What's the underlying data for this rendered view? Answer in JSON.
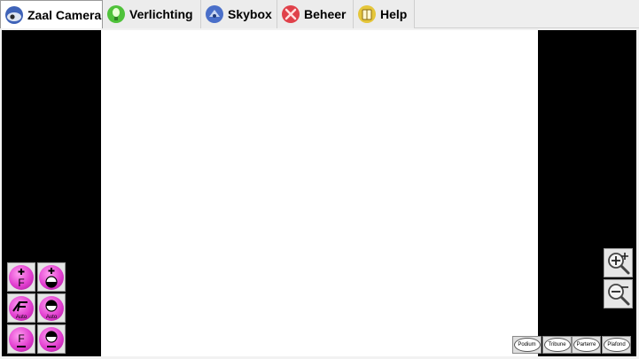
{
  "tabs": [
    {
      "label": "Zaal Camera",
      "icon": "camera-icon",
      "active": true
    },
    {
      "label": "Verlichting",
      "icon": "lightbulb-icon",
      "active": false
    },
    {
      "label": "Skybox",
      "icon": "skybox-icon",
      "active": false
    },
    {
      "label": "Beheer",
      "icon": "tools-icon",
      "active": false
    },
    {
      "label": "Help",
      "icon": "book-icon",
      "active": false
    }
  ],
  "camera_controls": {
    "focus_auto_label": "Auto",
    "iris_auto_label": "Auto",
    "focus_letter": "F"
  },
  "presets": [
    "Podium",
    "Tribune",
    "Parterre",
    "Plafond"
  ],
  "colors": {
    "accent_magenta": "#e23fd0",
    "panel_black": "#000000"
  }
}
